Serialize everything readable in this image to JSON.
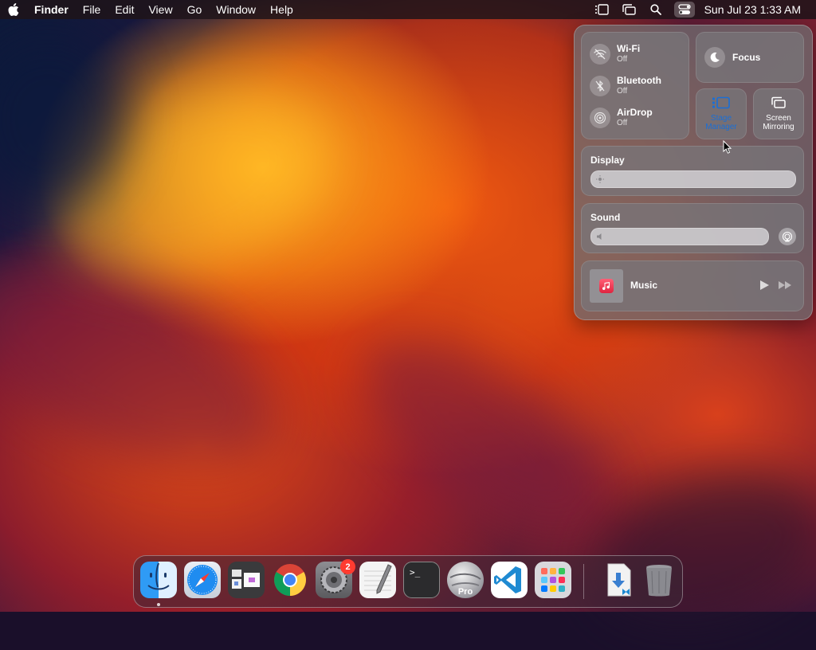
{
  "menubar": {
    "app_name": "Finder",
    "menus": [
      "File",
      "Edit",
      "View",
      "Go",
      "Window",
      "Help"
    ],
    "clock": "Sun Jul 23  1:33 AM",
    "status_icons": [
      "sidebar-icon",
      "stage-manager-icon",
      "search-icon",
      "control-center-icon"
    ]
  },
  "control_center": {
    "connectivity": [
      {
        "name": "Wi-Fi",
        "state": "Off",
        "icon": "wifi-off-icon"
      },
      {
        "name": "Bluetooth",
        "state": "Off",
        "icon": "bluetooth-icon"
      },
      {
        "name": "AirDrop",
        "state": "Off",
        "icon": "airdrop-icon"
      }
    ],
    "focus_label": "Focus",
    "stage_manager": {
      "line1": "Stage",
      "line2": "Manager",
      "active": true
    },
    "screen_mirroring": {
      "line1": "Screen",
      "line2": "Mirroring"
    },
    "display": {
      "title": "Display",
      "level": 0
    },
    "sound": {
      "title": "Sound",
      "level": 0
    },
    "now_playing": {
      "title": "Music"
    },
    "colors": {
      "accent": "#1a6fd6"
    }
  },
  "dock": {
    "apps": [
      {
        "name": "Finder",
        "icon": "finder-icon",
        "running": true
      },
      {
        "name": "Safari",
        "icon": "safari-icon"
      },
      {
        "name": "Stage Manager",
        "icon": "windows-icon"
      },
      {
        "name": "Chrome",
        "icon": "chrome-icon"
      },
      {
        "name": "System Settings",
        "icon": "settings-icon",
        "badge": "2"
      },
      {
        "name": "TextEdit",
        "icon": "textedit-icon"
      },
      {
        "name": "Terminal",
        "icon": "terminal-icon",
        "glyph": ">_"
      },
      {
        "name": "Google Earth Pro",
        "icon": "earth-icon",
        "label": "Pro"
      },
      {
        "name": "Visual Studio Code",
        "icon": "vscode-icon"
      },
      {
        "name": "Launchpad",
        "icon": "launchpad-icon"
      },
      {
        "name": "Downloads",
        "icon": "downloads-icon"
      },
      {
        "name": "Trash",
        "icon": "trash-icon"
      }
    ]
  }
}
